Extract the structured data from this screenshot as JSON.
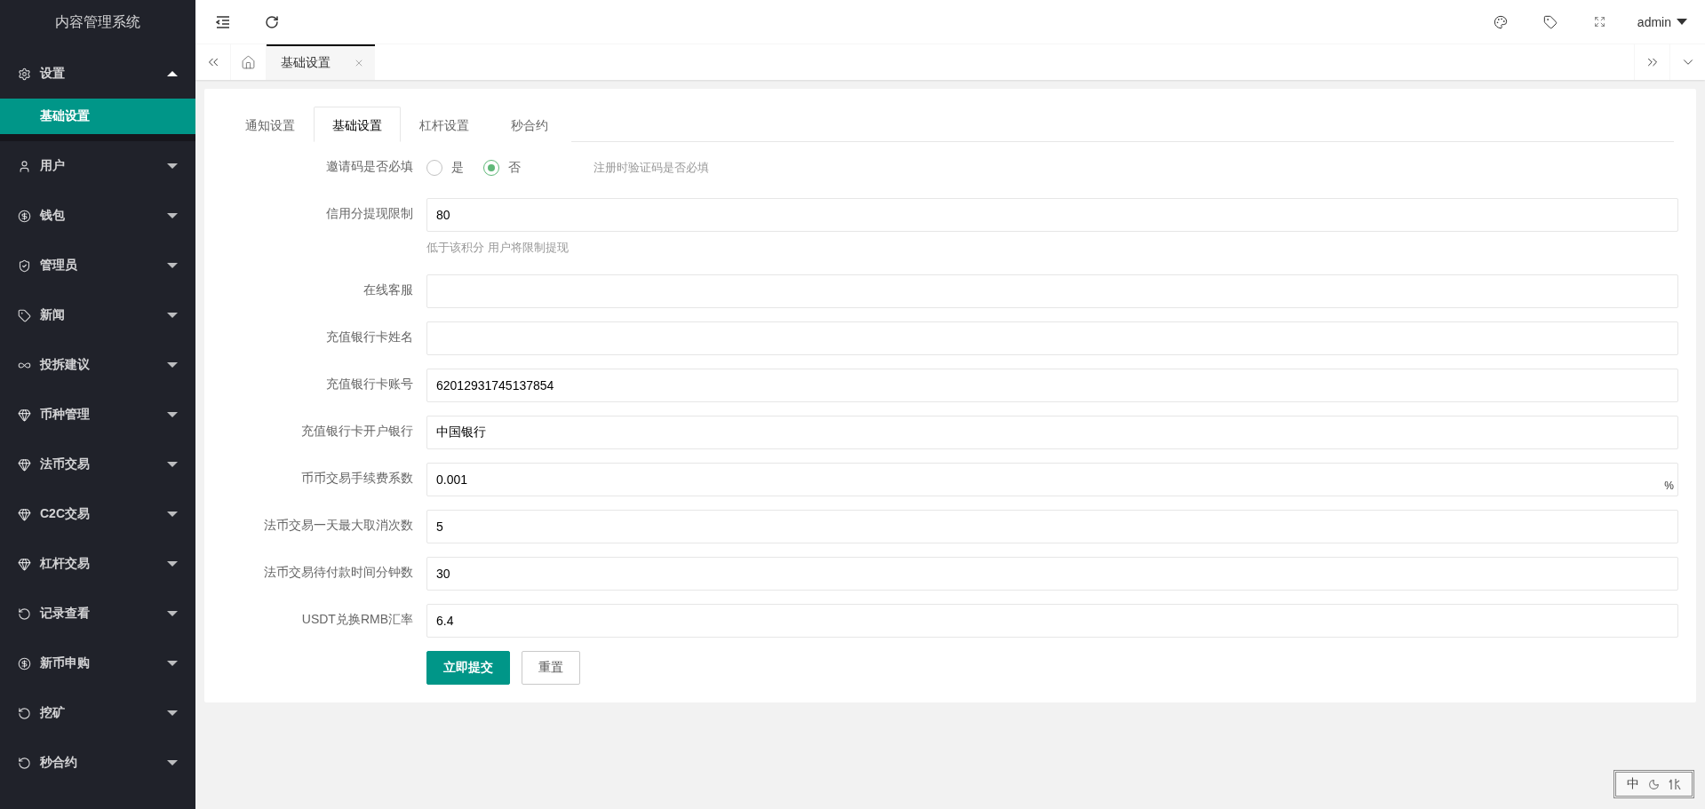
{
  "sidebar": {
    "title": "内容管理系统",
    "items": [
      {
        "label": "设置",
        "expanded": true,
        "children": [
          {
            "label": "基础设置",
            "selected": true
          }
        ]
      },
      {
        "label": "用户",
        "expanded": false
      },
      {
        "label": "钱包",
        "expanded": false
      },
      {
        "label": "管理员",
        "expanded": false
      },
      {
        "label": "新闻",
        "expanded": false
      },
      {
        "label": "投拆建议",
        "expanded": false
      },
      {
        "label": "币种管理",
        "expanded": false
      },
      {
        "label": "法币交易",
        "expanded": false
      },
      {
        "label": "C2C交易",
        "expanded": false
      },
      {
        "label": "杠杆交易",
        "expanded": false
      },
      {
        "label": "记录查看",
        "expanded": false
      },
      {
        "label": "新币申购",
        "expanded": false
      },
      {
        "label": "挖矿",
        "expanded": false
      },
      {
        "label": "秒合约",
        "expanded": false
      }
    ]
  },
  "header": {
    "user": "admin"
  },
  "page_tabs": [
    {
      "label": "基础设置",
      "selected": true
    }
  ],
  "form_tabs": [
    {
      "label": "通知设置",
      "selected": false
    },
    {
      "label": "基础设置",
      "selected": true
    },
    {
      "label": "杠杆设置",
      "selected": false
    },
    {
      "label": "秒合约",
      "selected": false
    }
  ],
  "fields": [
    {
      "kind": "radio",
      "label": "邀请码是否必填",
      "options": [
        {
          "label": "是",
          "selected": false
        },
        {
          "label": "否",
          "selected": true
        }
      ],
      "hint": "注册时验证码是否必填"
    },
    {
      "kind": "input",
      "label": "信用分提现限制",
      "value": "80",
      "help": "低于该积分 用户将限制提现"
    },
    {
      "kind": "input",
      "label": "在线客服"
    },
    {
      "kind": "input",
      "label": "充值银行卡姓名"
    },
    {
      "kind": "input",
      "label": "充值银行卡账号",
      "value": "62012931745137854"
    },
    {
      "kind": "input",
      "label": "充值银行卡开户银行",
      "value": "中国银行"
    },
    {
      "kind": "input",
      "label": "币币交易手续费系数",
      "value": "0.001",
      "suffix": "%"
    },
    {
      "kind": "input",
      "label": "法币交易一天最大取消次数",
      "value": "5"
    },
    {
      "kind": "input",
      "label": "法币交易待付款时间分钟数",
      "value": "30"
    },
    {
      "kind": "input",
      "label": "USDT兑换RMB汇率",
      "value": "6.4"
    }
  ],
  "buttons": [
    {
      "label": "立即提交",
      "kind": "primary"
    },
    {
      "label": "重置",
      "kind": "default"
    }
  ],
  "ime": {
    "mode": "中"
  }
}
